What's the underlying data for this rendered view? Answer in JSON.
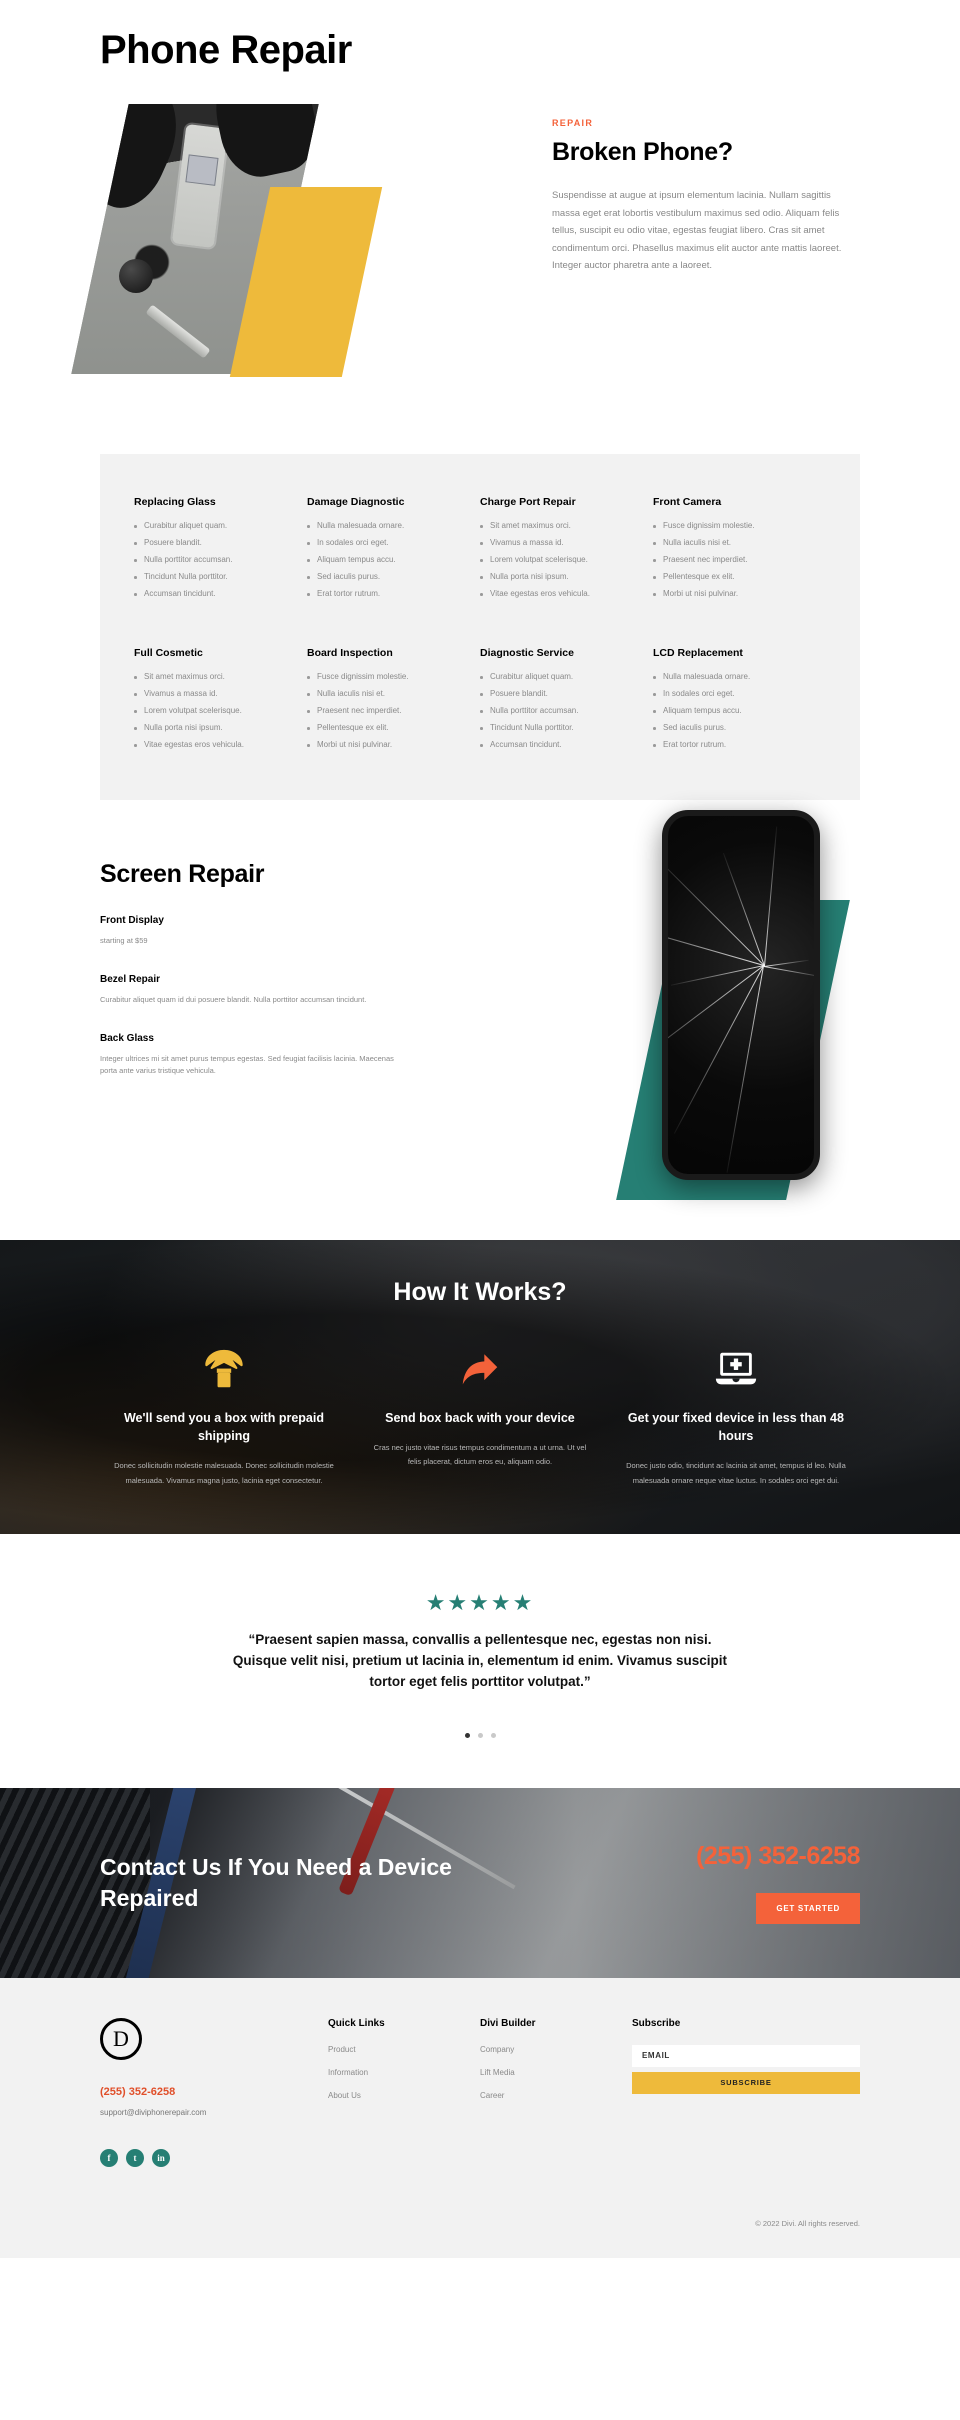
{
  "hero": {
    "title": "Phone Repair",
    "eyebrow": "REPAIR",
    "heading": "Broken Phone?",
    "paragraph": "Suspendisse at augue at ipsum elementum lacinia. Nullam sagittis massa eget erat lobortis vestibulum maximus sed odio. Aliquam felis tellus, suscipit eu odio vitae, egestas feugiat libero. Cras sit amet condimentum orci. Phasellus maximus elit auctor ante mattis laoreet. Integer auctor pharetra ante a laoreet."
  },
  "services": {
    "rows": [
      [
        {
          "title": "Replacing Glass",
          "items": [
            "Curabitur aliquet quam.",
            "Posuere blandit.",
            "Nulla porttitor accumsan.",
            "Tincidunt Nulla porttitor.",
            "Accumsan tincidunt."
          ]
        },
        {
          "title": "Damage Diagnostic",
          "items": [
            "Nulla malesuada ornare.",
            "In sodales orci eget.",
            "Aliquam tempus accu.",
            "Sed iaculis purus.",
            "Erat tortor rutrum."
          ]
        },
        {
          "title": "Charge Port Repair",
          "items": [
            "Sit amet maximus orci.",
            "Vivamus a massa id.",
            "Lorem volutpat scelerisque.",
            "Nulla porta nisi ipsum.",
            "Vitae egestas eros vehicula."
          ]
        },
        {
          "title": "Front Camera",
          "items": [
            "Fusce dignissim molestie.",
            "Nulla iaculis nisi et.",
            "Praesent nec imperdiet.",
            "Pellentesque ex elit.",
            "Morbi ut nisi pulvinar."
          ]
        }
      ],
      [
        {
          "title": "Full Cosmetic",
          "items": [
            "Sit amet maximus orci.",
            "Vivamus a massa id.",
            "Lorem volutpat scelerisque.",
            "Nulla porta nisi ipsum.",
            "Vitae egestas eros vehicula."
          ]
        },
        {
          "title": "Board Inspection",
          "items": [
            "Fusce dignissim molestie.",
            "Nulla iaculis nisi et.",
            "Praesent nec imperdiet.",
            "Pellentesque ex elit.",
            "Morbi ut nisi pulvinar."
          ]
        },
        {
          "title": "Diagnostic Service",
          "items": [
            "Curabitur aliquet quam.",
            "Posuere blandit.",
            "Nulla porttitor accumsan.",
            "Tincidunt Nulla porttitor.",
            "Accumsan tincidunt."
          ]
        },
        {
          "title": "LCD Replacement",
          "items": [
            "Nulla malesuada ornare.",
            "In sodales orci eget.",
            "Aliquam tempus accu.",
            "Sed iaculis purus.",
            "Erat tortor rutrum."
          ]
        }
      ]
    ]
  },
  "screen_repair": {
    "heading": "Screen Repair",
    "items": [
      {
        "title": "Front Display",
        "text": "starting at $59"
      },
      {
        "title": "Bezel Repair",
        "text": "Curabitur aliquet quam id dui posuere blandit. Nulla porttitor accumsan tincidunt."
      },
      {
        "title": "Back Glass",
        "text": "Integer ultrices mi sit amet purus tempus egestas. Sed feugiat facilisis lacinia. Maecenas porta ante varius tristique vehicula."
      }
    ]
  },
  "how_it_works": {
    "title": "How It Works?",
    "steps": [
      {
        "icon": "parachute-box-icon",
        "icon_color": "#eeba3b",
        "title": "We'll send you a box with prepaid shipping",
        "text": "Donec sollicitudin molestie malesuada. Donec sollicitudin molestie malesuada. Vivamus magna justo, lacinia eget consectetur."
      },
      {
        "icon": "share-arrow-icon",
        "icon_color": "#f4623a",
        "title": "Send box back with your device",
        "text": "Cras nec justo vitae risus tempus condimentum a ut urna. Ut vel felis placerat, dictum eros eu, aliquam odio."
      },
      {
        "icon": "laptop-medical-icon",
        "icon_color": "#ffffff",
        "title": "Get your fixed device in less than 48 hours",
        "text": "Donec justo odio, tincidunt ac lacinia sit amet, tempus id leo. Nulla malesuada ornare neque vitae luctus. In sodales orci eget dui."
      }
    ]
  },
  "testimonial": {
    "stars": "★★★★★",
    "rating": 5,
    "quote": "“Praesent sapien massa, convallis a pellentesque nec, egestas non nisi. Quisque velit nisi, pretium ut lacinia in, elementum id enim. Vivamus suscipit tortor eget felis porttitor volutpat.”",
    "slide_count": 3,
    "active_slide": 1
  },
  "cta": {
    "heading": "Contact Us If You Need a Device Repaired",
    "phone": "(255) 352-6258",
    "button": "GET STARTED"
  },
  "footer": {
    "logo_letter": "D",
    "phone": "(255) 352-6258",
    "email": "support@diviphonerepair.com",
    "socials": [
      {
        "name": "facebook-icon",
        "glyph": "f"
      },
      {
        "name": "twitter-icon",
        "glyph": "t"
      },
      {
        "name": "linkedin-icon",
        "glyph": "in"
      }
    ],
    "quick_links": {
      "title": "Quick Links",
      "items": [
        "Product",
        "Information",
        "About Us"
      ]
    },
    "divi_builder": {
      "title": "Divi Builder",
      "items": [
        "Company",
        "Lift Media",
        "Career"
      ]
    },
    "subscribe": {
      "title": "Subscribe",
      "input_value": "EMAIL",
      "placeholder": "EMAIL",
      "button": "SUBSCRIBE"
    },
    "copyright": "© 2022 Divi. All rights reserved."
  },
  "colors": {
    "accent_orange": "#f4623a",
    "accent_yellow": "#eeba3b",
    "accent_teal": "#267f74",
    "dark": "#1a1d20",
    "grey_bg": "#f2f2f2"
  }
}
